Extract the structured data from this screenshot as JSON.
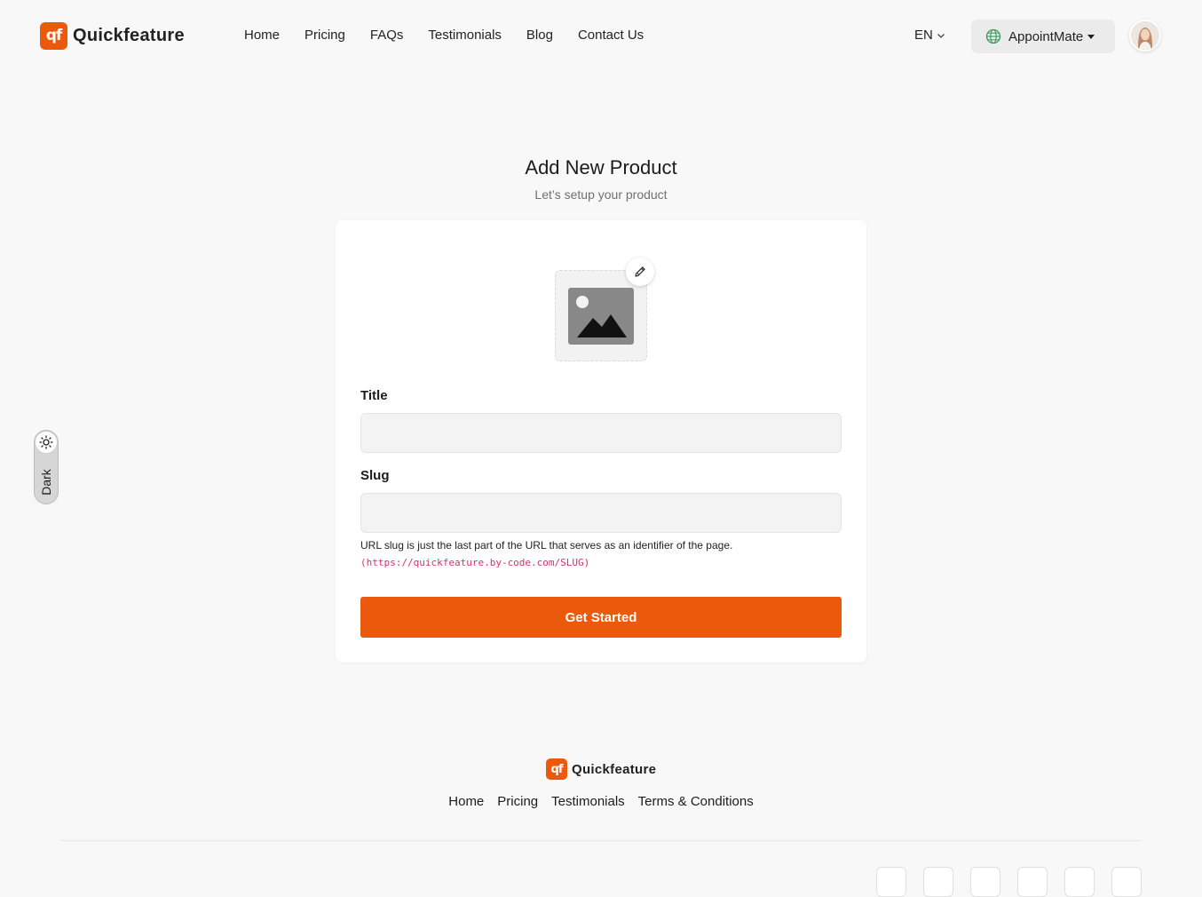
{
  "brand": {
    "name": "Quickfeature",
    "mark": "qf",
    "accent": "#eb5a0c"
  },
  "nav": {
    "items": [
      "Home",
      "Pricing",
      "FAQs",
      "Testimonials",
      "Blog",
      "Contact Us"
    ]
  },
  "language": {
    "value": "EN"
  },
  "workspace": {
    "name": "AppointMate",
    "icon": "globe-icon"
  },
  "theme_toggle": {
    "label": "Dark",
    "icon": "sun-icon"
  },
  "page": {
    "title": "Add New Product",
    "subtitle": "Let’s setup your product"
  },
  "form": {
    "image": {
      "icon": "image-placeholder-icon",
      "edit_icon": "pencil-icon"
    },
    "title": {
      "label": "Title",
      "value": "",
      "placeholder": ""
    },
    "slug": {
      "label": "Slug",
      "value": "",
      "placeholder": "",
      "help": "URL slug is just the last part of the URL that serves as an identifier of the page.",
      "help_code": "(https://quickfeature.by-code.com/SLUG)"
    },
    "submit_label": "Get Started"
  },
  "footer": {
    "brand": "Quickfeature",
    "links": [
      "Home",
      "Pricing",
      "Testimonials",
      "Terms & Conditions"
    ]
  }
}
